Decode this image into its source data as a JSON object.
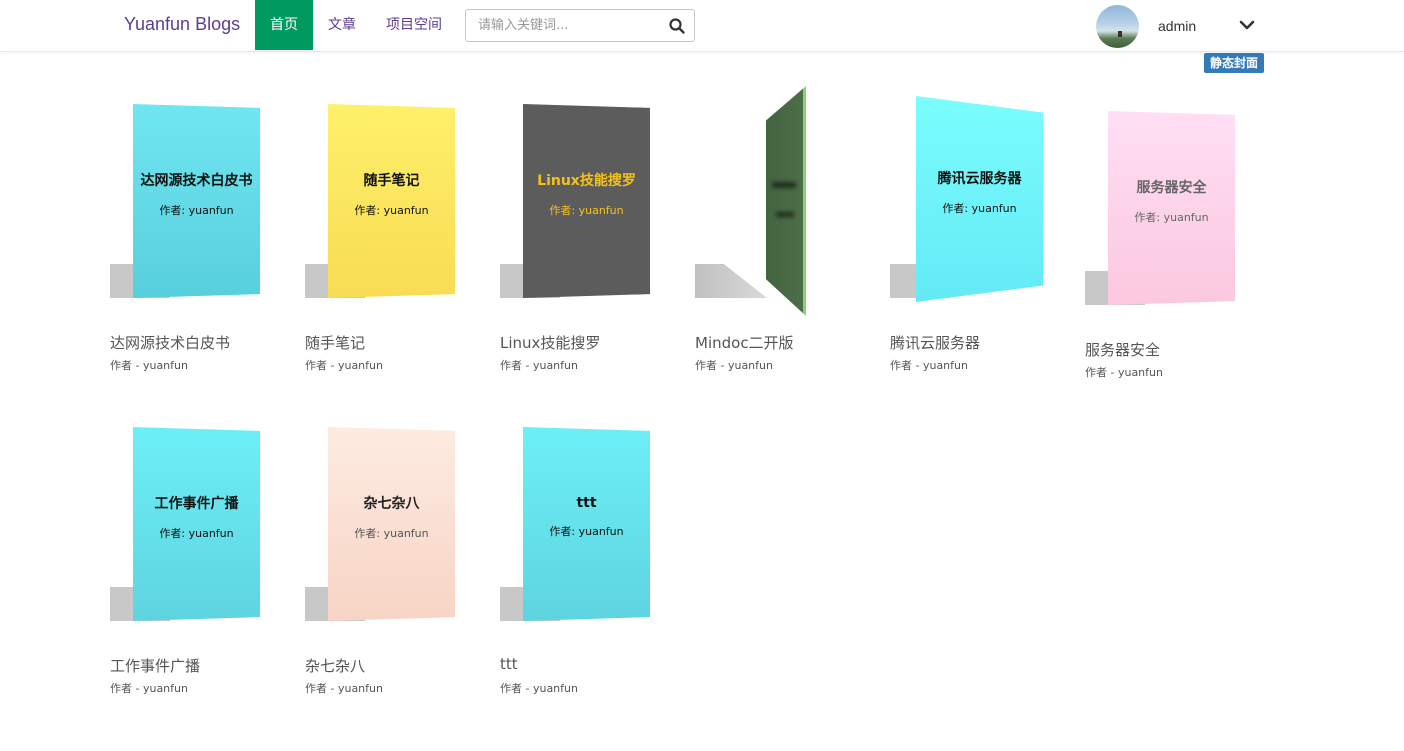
{
  "header": {
    "brand": "Yuanfun Blogs",
    "nav": [
      {
        "label": "首页",
        "active": true
      },
      {
        "label": "文章",
        "active": false
      },
      {
        "label": "项目空间",
        "active": false
      }
    ],
    "search": {
      "placeholder": "请输入关键词...",
      "value": "",
      "icon": "search-icon"
    },
    "user": {
      "name": "admin",
      "caret_icon": "chevron-down-icon"
    },
    "badge": "静态封面"
  },
  "books": [
    {
      "title": "达网源技术白皮书",
      "cover_title": "达网源技术白皮书",
      "cover_author": "作者: yuanfun",
      "byline": "作者 - yuanfun",
      "cover_color": "#5fd3e3",
      "text_color": "#111111"
    },
    {
      "title": "随手笔记",
      "cover_title": "随手笔记",
      "cover_author": "作者: yuanfun",
      "byline": "作者 - yuanfun",
      "cover_color": "#fde15a",
      "text_color": "#111111"
    },
    {
      "title": "Linux技能搜罗",
      "cover_title": "Linux技能搜罗",
      "cover_author": "作者: yuanfun",
      "byline": "作者 - yuanfun",
      "cover_color": "#5a5a5a",
      "text_color": "#f3c21a"
    },
    {
      "title": "Mindoc二开版",
      "byline": "作者 - yuanfun",
      "cover_color": "#46673f"
    },
    {
      "title": "腾讯云服务器",
      "cover_title": "腾讯云服务器",
      "cover_author": "作者: yuanfun",
      "byline": "作者 - yuanfun",
      "cover_color": "#6bf5f8",
      "text_color": "#111111"
    },
    {
      "title": "服务器安全",
      "cover_title": "服务器安全",
      "cover_author": "作者: yuanfun",
      "byline": "作者 - yuanfun",
      "cover_color": "#ffd6ec",
      "text_color": "#666666"
    },
    {
      "title": "工作事件广播",
      "cover_title": "工作事件广播",
      "cover_author": "作者: yuanfun",
      "byline": "作者 - yuanfun",
      "cover_color": "#5fd9e8",
      "text_color": "#111111"
    },
    {
      "title": "杂七杂八",
      "cover_title": "杂七杂八",
      "cover_author": "作者: yuanfun",
      "byline": "作者 - yuanfun",
      "cover_color": "#fcdccd",
      "text_color": "#333333"
    },
    {
      "title": "ttt",
      "cover_title": "ttt",
      "cover_author": "作者: yuanfun",
      "byline": "作者 - yuanfun",
      "cover_color": "#5fd9e8",
      "text_color": "#111111"
    }
  ],
  "colors": {
    "brand": "#5c3d8f",
    "nav_active": "#009a61",
    "badge": "#337ab7"
  }
}
